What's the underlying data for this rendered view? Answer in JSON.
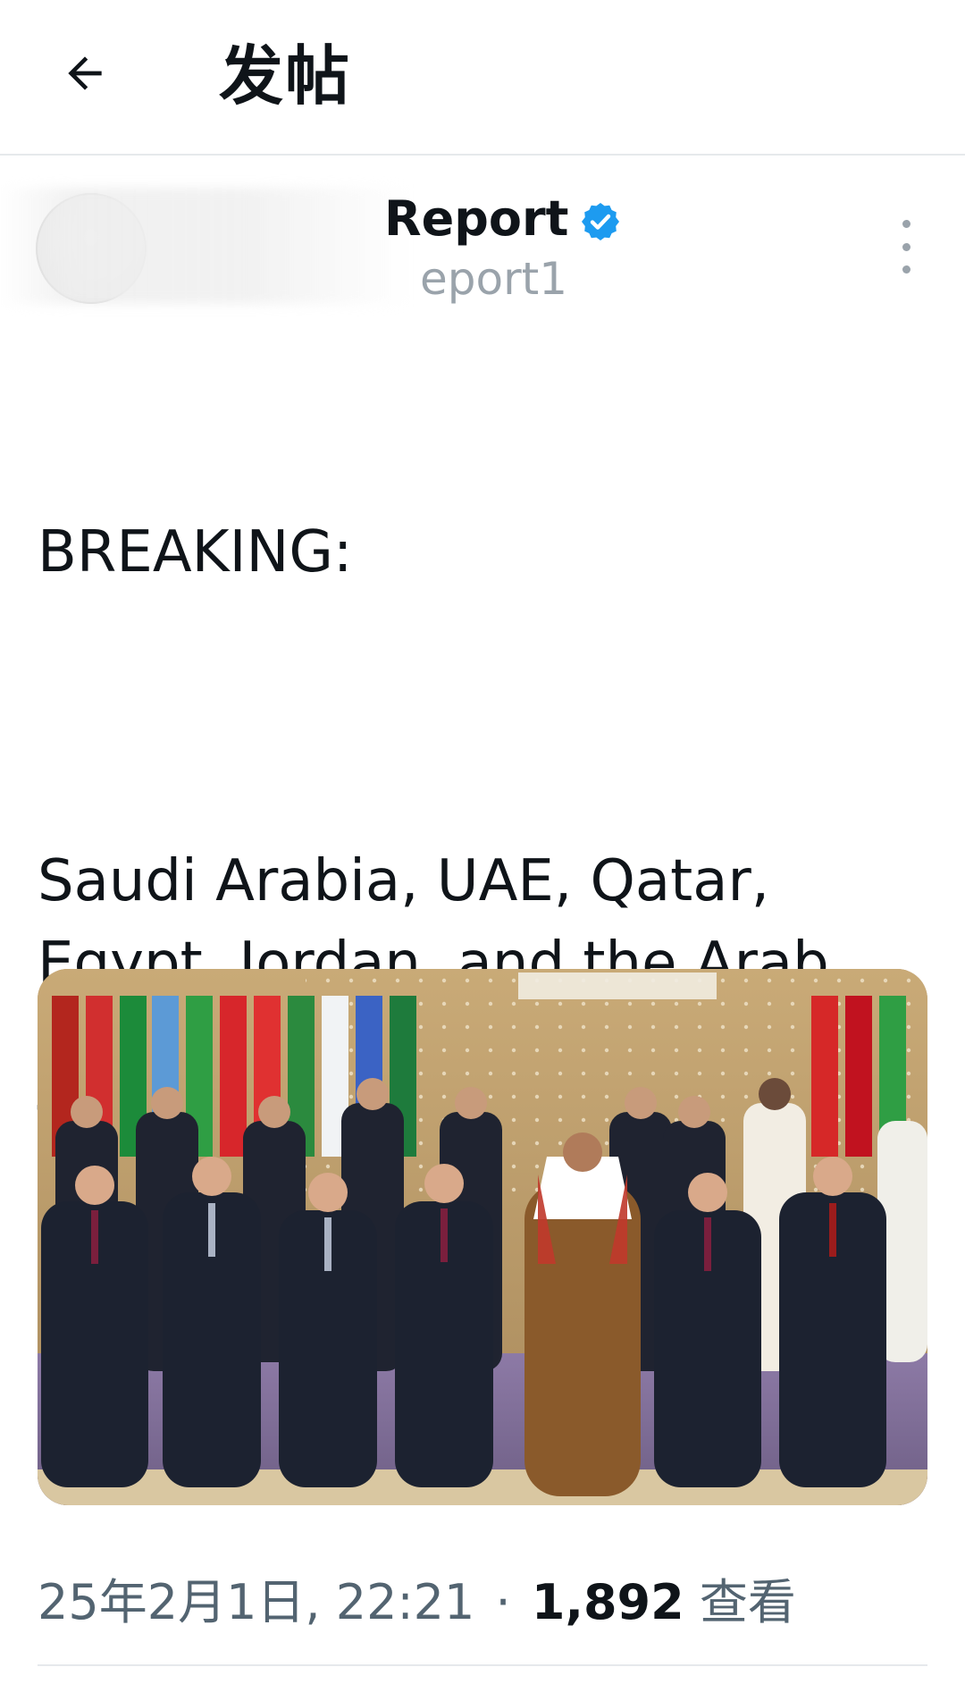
{
  "header": {
    "title": "发帖",
    "back_icon": "arrow-left-icon"
  },
  "author": {
    "display_name_visible": "Report",
    "handle_visible": "eport1",
    "verified": true,
    "verified_color": "#1d9bf0",
    "more_icon": "more-vertical-icon"
  },
  "tweet": {
    "text_line1": "BREAKING:",
    "text_body": "Saudi Arabia, UAE, Qatar,\nEgypt, Jordan, and the Arab\nLeague opposed President\nTrump's plan to relocate\nPalestinians from Gaza."
  },
  "media": {
    "type": "photo"
  },
  "meta": {
    "date_time": "25年2月1日, 22:21",
    "separator": "·",
    "views_count": "1,892",
    "views_label": "查看"
  }
}
